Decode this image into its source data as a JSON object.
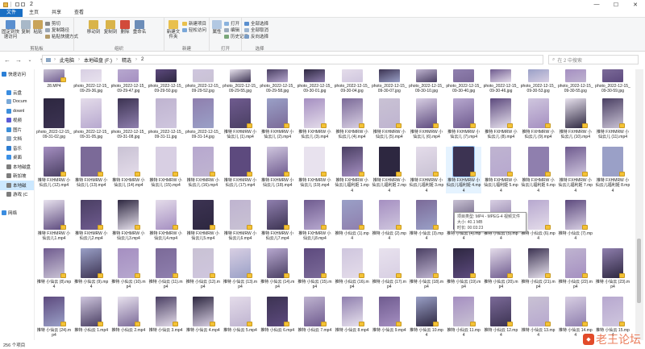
{
  "window": {
    "title": "2"
  },
  "tabs": [
    "文件",
    "主页",
    "共享",
    "查看"
  ],
  "ribbon": {
    "groups": [
      "剪贴板",
      "组织",
      "新建",
      "打开",
      "选择"
    ],
    "buttons": {
      "pin": "固定到快速访问",
      "copy": "复制",
      "paste": "粘贴",
      "cut": "剪切",
      "copy_path": "复制路径",
      "paste_shortcut": "粘贴快捷方式",
      "move_to": "移动到",
      "copy_to": "复制到",
      "delete": "删除",
      "rename": "重命名",
      "new_folder": "新建文件夹",
      "new_item": "新建项目",
      "easy_access": "轻松访问",
      "properties": "属性",
      "open": "打开",
      "edit": "编辑",
      "history": "历史记录",
      "select_all": "全部选择",
      "select_none": "全部取消",
      "invert": "反向选择"
    }
  },
  "address": {
    "crumbs": [
      "此电脑",
      "本地磁盘 (F:)",
      "精选",
      "2"
    ],
    "search_placeholder": "在 2 中搜索"
  },
  "nav": [
    {
      "label": "快速访问",
      "color": "#2b7fd6",
      "sel": false
    },
    {
      "label": "",
      "color": "#ffffff",
      "sel": false
    },
    {
      "label": "云盘",
      "color": "#3a8de0",
      "sel": false
    },
    {
      "label": "Docum",
      "color": "#7aa9d8",
      "sel": false
    },
    {
      "label": "downl",
      "color": "#3d8edb",
      "sel": false
    },
    {
      "label": "视频",
      "color": "#5b5bd6",
      "sel": false
    },
    {
      "label": "图片",
      "color": "#3b8fd9",
      "sel": false
    },
    {
      "label": "文档",
      "color": "#8aa6c4",
      "sel": false
    },
    {
      "label": "音乐",
      "color": "#2d7dd2",
      "sel": false
    },
    {
      "label": "桌面",
      "color": "#3c91e6",
      "sel": false
    },
    {
      "label": "本地磁盘",
      "color": "#7d7d7d",
      "sel": false
    },
    {
      "label": "新加坡",
      "color": "#7d7d7d",
      "sel": false
    },
    {
      "label": "本地磁",
      "color": "#7d7d7d",
      "sel": true
    },
    {
      "label": "游戏 (C",
      "color": "#7d7d7d",
      "sel": false
    },
    {
      "label": "",
      "color": "#ffffff",
      "sel": false
    },
    {
      "label": "网络",
      "color": "#3a8de0",
      "sel": false
    }
  ],
  "rows": [
    {
      "h": 36,
      "thumbH": 16,
      "captions": [
        "28.MP4",
        "photo_2022-12-15_09-29-36.jpg",
        "photo_2022-12-15_09-29-47.jpg",
        "photo_2022-12-15_09-29-50.jpg",
        "photo_2022-12-15_09-29-52.jpg",
        "photo_2022-12-15_09-29-55.jpg",
        "photo_2022-12-15_09-29-58.jpg",
        "photo_2022-12-15_09-30-01.jpg",
        "photo_2022-12-15_09-30-04.jpg",
        "photo_2022-12-15_09-30-07.jpg",
        "photo_2022-12-15_09-30-10.jpg",
        "photo_2022-12-15_09-30-40.jpg",
        "photo_2022-12-15_09-30-46.jpg",
        "photo_2022-12-15_09-30-53.jpg",
        "photo_2022-12-15_09-30-55.jpg",
        "photo_2022-12-15_09-30-59.jpg"
      ]
    },
    {
      "h": 60,
      "thumbH": 37,
      "captions": [
        "photo_2022-12-15_09-31-02.jpg",
        "photo_2022-12-15_09-31-05.jpg",
        "photo_2022-12-15_09-31-08.jpg",
        "photo_2022-12-15_09-31-11.jpg",
        "photo_2022-12-15_09-31-14.jpg",
        "推特 FXHMRW 小仙云儿 (1).mp4",
        "推特 FXHMRW 小仙云儿 (2).mp4",
        "推特 FXHMRW 小仙云儿 (3).mp4",
        "推特 FXHMRW 小仙云儿 (4).mp4",
        "推特 FXHMRW 小仙云儿 (5).mp4",
        "推特 FXHMRW 小仙云儿 (6).mp4",
        "推特 FXHMRW 小仙云儿 (7).mp4",
        "推特 FXHMRW 小仙云儿 (8).mp4",
        "推特 FXHMRW 小仙云儿 (9).mp4",
        "推特 FXHMRW 小仙云儿 (10).mp4",
        "推特 FXHMRW 小仙云儿 (11).mp4"
      ]
    },
    {
      "h": 66,
      "thumbH": 37,
      "captions": [
        "推特 FXHMRW 小仙云儿 (12).mp4",
        "推特 FXHMRW 小仙云儿 (13).mp4",
        "推特 FXHMRW 小仙云儿 (14).mp4",
        "推特 FXHMRW 小仙云儿 (15).mp4",
        "推特 FXHMRW 小仙云儿 (16).mp4",
        "推特 FXHMRW 小仙云儿 (17).mp4",
        "推特 FXHMRW 小仙云儿 (18).mp4",
        "推特 FXHMRW 小仙云儿 (19).mp4",
        "推特 FXHMRW 小仙云儿福利姬 1.mp4",
        "推特 FXHMRW 小仙云儿福利姬 2.mp4",
        "推特 FXHMRW 小仙云儿福利姬 3.mp4",
        "推特 FXHMRW 小仙云儿福利姬 4.mp4",
        "推特 FXHMRW 小仙云儿福利姬 5.mp4",
        "推特 FXHMRW 小仙云儿福利姬 6.mp4",
        "推特 FXHMRW 小仙云儿福利姬 7.mp4",
        "推特 FXHMRW 小仙云儿福利姬 8.mp4"
      ]
    },
    {
      "h": 60,
      "thumbH": 37,
      "captions": [
        "推特 FXHMRW 小仙云儿1.mp4",
        "推特 FXHMRW 小仙云儿2.mp4",
        "推特 FXHMRW 小仙云儿3.mp4",
        "推特 FXHMRW 小仙云儿4.mp4",
        "推特 FXHMRW 小仙云儿5.mp4",
        "推特 FXHMRW 小仙云儿6.mp4",
        "推特 FXHMRW 小仙云儿7.mp4",
        "推特 FXHMRW 小仙云儿8.mp4",
        "推特 小仙云 (1).mp4",
        "推特 小仙云 (2).mp4",
        "推特 小仙云 (3).mp4",
        "推特 小仙云 (4).mp4",
        "推特 小仙云 (5).mp4",
        "推特 小仙云 (6).mp4",
        "推特 小仙云 (7).mp4",
        ""
      ]
    },
    {
      "h": 60,
      "thumbH": 37,
      "captions": [
        "推特 小仙云 (8).mp4",
        "推特 小仙云 (9).mp4",
        "推特 小仙云 (10).mp4",
        "推特 小仙云 (11).mp4",
        "推特 小仙云 (12).mp4",
        "推特 小仙云 (13).mp4",
        "推特 小仙云 (14).mp4",
        "推特 小仙云 (15).mp4",
        "推特 小仙云 (16).mp4",
        "推特 小仙云 (17).mp4",
        "推特 小仙云 (18).mp4",
        "推特 小仙云 (19).mp4",
        "推特 小仙云 (20).mp4",
        "推特 小仙云 (21).mp4",
        "推特 小仙云 (22).mp4",
        "推特 小仙云 (23).mp4"
      ]
    },
    {
      "h": 54,
      "thumbH": 37,
      "captions": [
        "推特 小仙云 (24).mp4",
        "推特 小仙云 1.mp4",
        "推特 小仙云 2.mp4",
        "推特 小仙云 3.mp4",
        "推特 小仙云 4.mp4",
        "推特 小仙云 5.mp4",
        "推特 小仙云 6.mp4",
        "推特 小仙云 7.mp4",
        "推特 小仙云 8.mp4",
        "推特 小仙云 9.mp4",
        "推特 小仙云 10.mp4",
        "推特 小仙云 11.mp4",
        "推特 小仙云 12.mp4",
        "推特 小仙云 13.mp4",
        "推特 小仙云 14.mp4",
        "推特 小仙云 15.mp4"
      ]
    }
  ],
  "thumb_palette": [
    "#c9c2d4",
    "#8f7fae",
    "#4a3f63",
    "#d8cfe3",
    "#6f5b8f",
    "#2d2740",
    "#b7a8cf",
    "#9aa0c7",
    "#e4dcea",
    "#5d4a7e",
    "#a58fc1",
    "#3c3352",
    "#cfc6de",
    "#7b6a98",
    "#bfb4d0",
    "#e8e2ee"
  ],
  "tooltip": {
    "line1": "项目类型: MP4 - MPEG-4 视频文件",
    "line2": "大小: 40.1 MB",
    "line3": "时长: 00:03:23"
  },
  "status": {
    "count": "256 个项目"
  },
  "watermark": {
    "text": "老王论坛"
  }
}
